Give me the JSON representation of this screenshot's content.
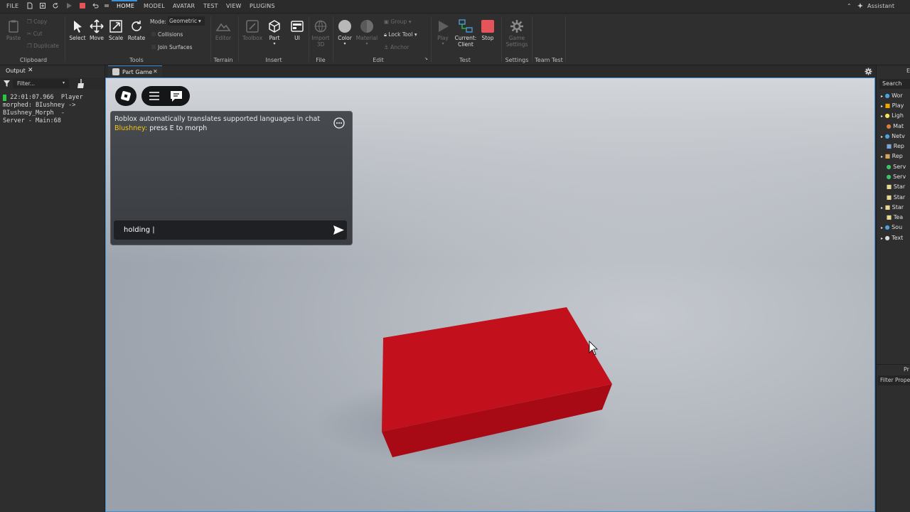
{
  "menubar": {
    "file": "FILE",
    "tabs": [
      "HOME",
      "MODEL",
      "AVATAR",
      "TEST",
      "VIEW",
      "PLUGINS"
    ],
    "assistant": "Assistant"
  },
  "ribbon": {
    "clipboard": {
      "paste": "Paste",
      "copy": "Copy",
      "cut": "Cut",
      "duplicate": "Duplicate",
      "group": "Clipboard"
    },
    "tools": {
      "select": "Select",
      "move": "Move",
      "scale": "Scale",
      "rotate": "Rotate",
      "mode_label": "Mode:",
      "mode_value": "Geometric",
      "collisions": "Collisions",
      "join_surfaces": "Join Surfaces",
      "group": "Tools"
    },
    "terrain": {
      "editor": "Editor",
      "group": "Terrain"
    },
    "insert": {
      "toolbox": "Toolbox",
      "part": "Part",
      "ui": "UI",
      "group": "Insert"
    },
    "file": {
      "import3d_l1": "Import",
      "import3d_l2": "3D",
      "group": "File"
    },
    "edit": {
      "color": "Color",
      "material": "Material",
      "group_btn": "Group",
      "lock_tool": "Lock Tool",
      "anchor": "Anchor",
      "group": "Edit"
    },
    "test": {
      "play": "Play",
      "current_l1": "Current:",
      "current_l2": "Client",
      "stop": "Stop",
      "group": "Test"
    },
    "settings": {
      "game_l1": "Game",
      "game_l2": "Settings",
      "group": "Settings"
    },
    "team_test": {
      "group": "Team Test"
    }
  },
  "output": {
    "tab": "Output",
    "filter_placeholder": "Filter...",
    "log": "  22:01:07.966  Player\nmorphed: BIushney ->\nBIushney_Morph  -\nServer - Main:68"
  },
  "viewport": {
    "tab": "Part Game"
  },
  "chat": {
    "system_message": "Roblox automatically translates supported languages in chat",
    "sender": "Blushney:",
    "message": "press E to morph",
    "input_value": "holding |"
  },
  "explorer": {
    "search": "Search",
    "items": [
      "Wor",
      "Play",
      "Ligh",
      "Mat",
      "Netv",
      "Rep",
      "Rep",
      "Serv",
      "Serv",
      "Star",
      "Star",
      "Star",
      "Tea",
      "Sou",
      "Text"
    ],
    "properties_tab": "Pr",
    "filter_properties": "Filter Prope",
    "top_label": "E"
  },
  "colors": {
    "accent": "#3d8fd6",
    "part_red": "#c4101e",
    "stop_red": "#e5535b",
    "chat_sender": "#f2c618",
    "log_marker": "#27c93f"
  }
}
